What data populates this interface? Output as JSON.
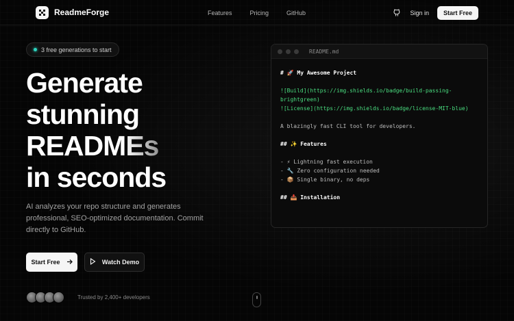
{
  "brand": {
    "name": "ReadmeForge"
  },
  "nav": {
    "links": [
      "Features",
      "Pricing",
      "GitHub"
    ],
    "signin": "Sign in",
    "cta": "Start Free"
  },
  "hero": {
    "badge": "3 free generations to start",
    "headline": [
      "Generate",
      "stunning",
      "READMEs",
      "in seconds"
    ],
    "subtext": "AI analyzes your repo structure and generates professional, SEO-optimized documentation. Commit directly to GitHub.",
    "primary_cta": "Start Free",
    "secondary_cta": "Watch Demo",
    "trusted": "Trusted by 2,400+ developers"
  },
  "editor": {
    "filename": "README.md",
    "lines": [
      {
        "text": "# 🚀 My Awesome Project",
        "kind": "h"
      },
      {
        "text": "",
        "kind": "blank"
      },
      {
        "text": "![Build](https://img.shields.io/badge/build-passing-",
        "kind": "link"
      },
      {
        "text": "brightgreen)",
        "kind": "link"
      },
      {
        "text": "![License](https://img.shields.io/badge/license-MIT-blue)",
        "kind": "link"
      },
      {
        "text": "",
        "kind": "blank"
      },
      {
        "text": "A blazingly fast CLI tool for developers.",
        "kind": "text"
      },
      {
        "text": "",
        "kind": "blank"
      },
      {
        "text": "## ✨ Features",
        "kind": "h"
      },
      {
        "text": "",
        "kind": "blank"
      },
      {
        "text": "- ⚡ Lightning fast execution",
        "kind": "text"
      },
      {
        "text": "- 🔧 Zero configuration needed",
        "kind": "text"
      },
      {
        "text": "- 📦 Single binary, no deps",
        "kind": "text"
      },
      {
        "text": "",
        "kind": "blank"
      },
      {
        "text": "## 📥 Installation",
        "kind": "h"
      }
    ]
  },
  "colors": {
    "accent": "#2dd4bf",
    "link": "#4ade80",
    "background": "#050505"
  }
}
